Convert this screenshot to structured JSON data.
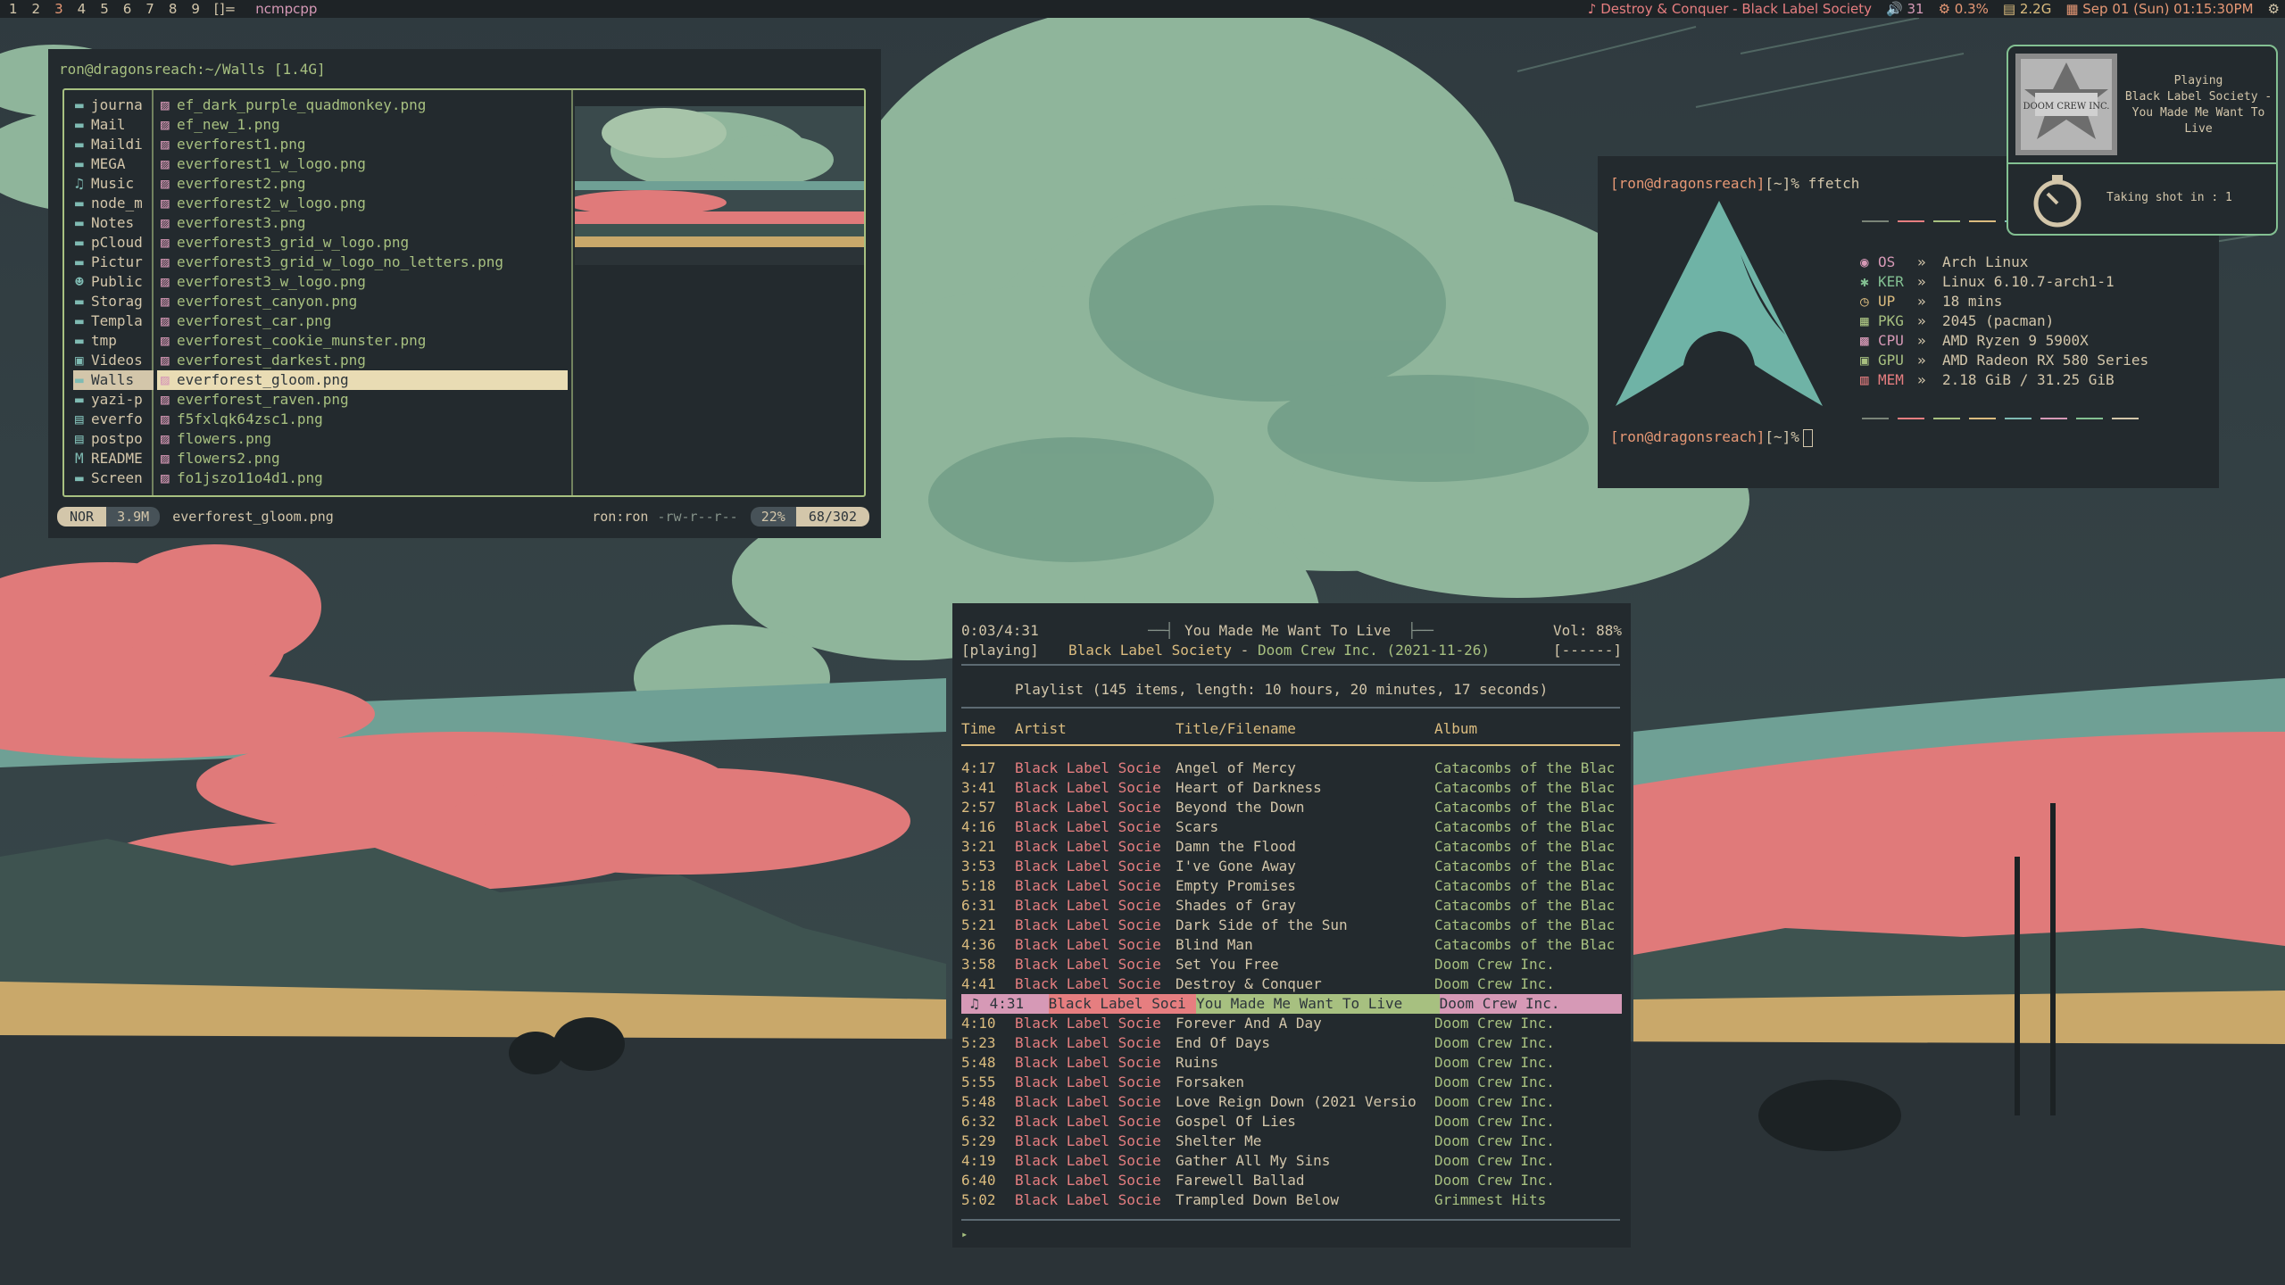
{
  "colors": {
    "bg": "#2d353b",
    "fg": "#d3c6aa",
    "green": "#a7c080",
    "red": "#e67e80",
    "yellow": "#dbbc7f",
    "orange": "#e69875",
    "blue": "#7fbbb3",
    "purple": "#d699b6",
    "aqua": "#83c092"
  },
  "topbar": {
    "workspaces": [
      "1",
      "2",
      "3",
      "4",
      "5",
      "6",
      "7",
      "8",
      "9"
    ],
    "active_workspace": "3",
    "layout_icon": "[]=",
    "window_title": "ncmpcpp",
    "now_playing": "♪ Destroy & Conquer - Black Label Society",
    "volume": "🔊 31",
    "cpu": "⚙ 0.3%",
    "memory": "▤ 2.2G",
    "clock": "▦ Sep 01 (Sun) 01:15:30PM",
    "tray": "⚙"
  },
  "yazi": {
    "header": "ron@dragonsreach:~/Walls [1.4G]",
    "parent": [
      {
        "icon": "folder-icon",
        "name": "journa"
      },
      {
        "icon": "folder-icon",
        "name": "Mail"
      },
      {
        "icon": "folder-icon",
        "name": "Maildi"
      },
      {
        "icon": "folder-icon",
        "name": "MEGA"
      },
      {
        "icon": "headphones-icon",
        "name": "Music"
      },
      {
        "icon": "folder-icon",
        "name": "node_m"
      },
      {
        "icon": "folder-icon",
        "name": "Notes"
      },
      {
        "icon": "folder-icon",
        "name": "pCloud"
      },
      {
        "icon": "folder-icon",
        "name": "Pictur"
      },
      {
        "icon": "users-icon",
        "name": "Public"
      },
      {
        "icon": "folder-icon",
        "name": "Storag"
      },
      {
        "icon": "folder-icon",
        "name": "Templa"
      },
      {
        "icon": "folder-icon",
        "name": "tmp"
      },
      {
        "icon": "video-icon",
        "name": "Videos"
      },
      {
        "icon": "folder-icon",
        "name": "Walls"
      },
      {
        "icon": "folder-icon",
        "name": "yazi-p"
      },
      {
        "icon": "file-icon",
        "name": "everfo"
      },
      {
        "icon": "file-icon",
        "name": "postpo"
      },
      {
        "icon": "markdown-icon",
        "name": "README"
      },
      {
        "icon": "folder-icon",
        "name": "Screen"
      }
    ],
    "parent_selected": 14,
    "files": [
      "ef_dark_purple_quadmonkey.png",
      "ef_new_1.png",
      "everforest1.png",
      "everforest1_w_logo.png",
      "everforest2.png",
      "everforest2_w_logo.png",
      "everforest3.png",
      "everforest3_grid_w_logo.png",
      "everforest3_grid_w_logo_no_letters.png",
      "everforest3_w_logo.png",
      "everforest_canyon.png",
      "everforest_car.png",
      "everforest_cookie_munster.png",
      "everforest_darkest.png",
      "everforest_gloom.png",
      "everforest_raven.png",
      "f5fxlqk64zsc1.png",
      "flowers.png",
      "flowers2.png",
      "fo1jszo11o4d1.png"
    ],
    "files_selected": 14,
    "status": {
      "mode": "NOR",
      "size": "3.9M",
      "filename": "everforest_gloom.png",
      "owner": "ron:ron",
      "perms": "-rw-r--r--",
      "percent": "22%",
      "position": "68/302"
    }
  },
  "fastfetch": {
    "prompt_user": "[ron@dragonsreach]",
    "prompt_dir": "[~]%",
    "command": "ffetch",
    "info": [
      {
        "icon": "arch-icon",
        "key": "OS",
        "value": "Arch Linux",
        "color": "#d699b6"
      },
      {
        "icon": "gear-icon",
        "key": "KER",
        "value": "Linux 6.10.7-arch1-1",
        "color": "#83c092"
      },
      {
        "icon": "clock-icon",
        "key": "UP",
        "value": "18 mins",
        "color": "#dbbc7f"
      },
      {
        "icon": "package-icon",
        "key": "PKG",
        "value": "2045 (pacman)",
        "color": "#a7c080"
      },
      {
        "icon": "cpu-icon",
        "key": "CPU",
        "value": "AMD Ryzen 9 5900X",
        "color": "#d699b6"
      },
      {
        "icon": "gpu-icon",
        "key": "GPU",
        "value": "AMD Radeon RX 580 Series",
        "color": "#a7c080"
      },
      {
        "icon": "memory-icon",
        "key": "MEM",
        "value": "2.18 GiB / 31.25 GiB",
        "color": "#e67e80"
      }
    ],
    "palette": [
      "#7a8478",
      "#e67e80",
      "#a7c080",
      "#dbbc7f",
      "#7fbbb3",
      "#d699b6",
      "#83c092",
      "#d3c6aa"
    ]
  },
  "notification": {
    "title": "Playing",
    "body": "Black Label Society - You Made Me Want To Live",
    "shot": "Taking shot in : 1",
    "art_text": "DOOM CREW INC."
  },
  "ncmpcpp": {
    "elapsed": "0:03/4:31",
    "state": "[playing]",
    "now_title": "You Made Me Want To Live",
    "now_artist": "Black Label Society",
    "now_sep": "-",
    "now_album": "Doom Crew Inc. (2021-11-26)",
    "volume": "Vol: 88%",
    "flags": "[------]",
    "playlist_info": "Playlist (145 items, length: 10 hours, 20 minutes, 17 seconds)",
    "columns": [
      "Time",
      "Artist",
      "Title/Filename",
      "Album"
    ],
    "playing_index": 12,
    "playing_marker": "♫",
    "rows": [
      {
        "time": "4:17",
        "artist": "Black Label Socie",
        "title": "Angel of Mercy",
        "album": "Catacombs of the Blac"
      },
      {
        "time": "3:41",
        "artist": "Black Label Socie",
        "title": "Heart of Darkness",
        "album": "Catacombs of the Blac"
      },
      {
        "time": "2:57",
        "artist": "Black Label Socie",
        "title": "Beyond the Down",
        "album": "Catacombs of the Blac"
      },
      {
        "time": "4:16",
        "artist": "Black Label Socie",
        "title": "Scars",
        "album": "Catacombs of the Blac"
      },
      {
        "time": "3:21",
        "artist": "Black Label Socie",
        "title": "Damn the Flood",
        "album": "Catacombs of the Blac"
      },
      {
        "time": "3:53",
        "artist": "Black Label Socie",
        "title": "I've Gone Away",
        "album": "Catacombs of the Blac"
      },
      {
        "time": "5:18",
        "artist": "Black Label Socie",
        "title": "Empty Promises",
        "album": "Catacombs of the Blac"
      },
      {
        "time": "6:31",
        "artist": "Black Label Socie",
        "title": "Shades of Gray",
        "album": "Catacombs of the Blac"
      },
      {
        "time": "5:21",
        "artist": "Black Label Socie",
        "title": "Dark Side of the Sun",
        "album": "Catacombs of the Blac"
      },
      {
        "time": "4:36",
        "artist": "Black Label Socie",
        "title": "Blind Man",
        "album": "Catacombs of the Blac"
      },
      {
        "time": "3:58",
        "artist": "Black Label Socie",
        "title": "Set You Free",
        "album": "Doom Crew Inc."
      },
      {
        "time": "4:41",
        "artist": "Black Label Socie",
        "title": "Destroy & Conquer",
        "album": "Doom Crew Inc."
      },
      {
        "time": "4:31",
        "artist": "Black Label Soci",
        "title": "You Made Me Want To Live",
        "album": "Doom Crew Inc."
      },
      {
        "time": "4:10",
        "artist": "Black Label Socie",
        "title": "Forever And A Day",
        "album": "Doom Crew Inc."
      },
      {
        "time": "5:23",
        "artist": "Black Label Socie",
        "title": "End Of Days",
        "album": "Doom Crew Inc."
      },
      {
        "time": "5:48",
        "artist": "Black Label Socie",
        "title": "Ruins",
        "album": "Doom Crew Inc."
      },
      {
        "time": "5:55",
        "artist": "Black Label Socie",
        "title": "Forsaken",
        "album": "Doom Crew Inc."
      },
      {
        "time": "5:48",
        "artist": "Black Label Socie",
        "title": "Love Reign Down (2021 Versio",
        "album": "Doom Crew Inc."
      },
      {
        "time": "6:32",
        "artist": "Black Label Socie",
        "title": "Gospel Of Lies",
        "album": "Doom Crew Inc."
      },
      {
        "time": "5:29",
        "artist": "Black Label Socie",
        "title": "Shelter Me",
        "album": "Doom Crew Inc."
      },
      {
        "time": "4:19",
        "artist": "Black Label Socie",
        "title": "Gather All My Sins",
        "album": "Doom Crew Inc."
      },
      {
        "time": "6:40",
        "artist": "Black Label Socie",
        "title": "Farewell Ballad",
        "album": "Doom Crew Inc."
      },
      {
        "time": "5:02",
        "artist": "Black Label Socie",
        "title": "Trampled Down Below",
        "album": "Grimmest Hits"
      }
    ]
  }
}
